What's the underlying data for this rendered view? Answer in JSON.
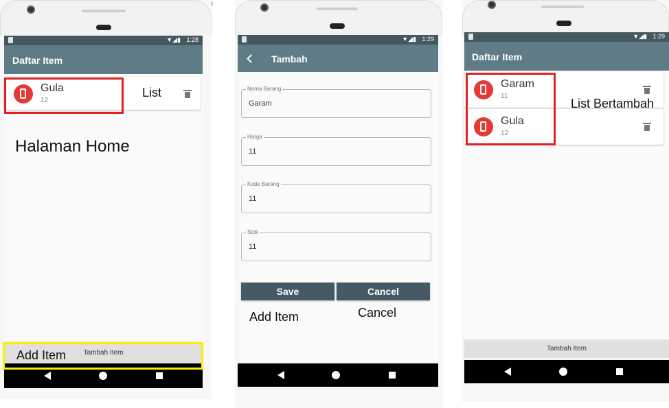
{
  "edge_fragment": "Bai",
  "phone1": {
    "status_time": "1:28",
    "appbar_title": "Daftar Item",
    "items": [
      {
        "title": "Gula",
        "subtitle": "12"
      }
    ],
    "bottom_button": "Tambah Item",
    "annotations": {
      "list": "List",
      "home": "Halaman Home",
      "add": "Add Item"
    }
  },
  "phone2": {
    "status_time": "1:29",
    "appbar_title": "Tambah",
    "fields": [
      {
        "label": "Nama Barang",
        "value": "Garam"
      },
      {
        "label": "Harga",
        "value": "11"
      },
      {
        "label": "Kode Barang",
        "value": "11"
      },
      {
        "label": "Stok",
        "value": "11"
      }
    ],
    "save_label": "Save",
    "cancel_label": "Cancel",
    "annotations": {
      "add": "Add Item",
      "cancel": "Cancel"
    }
  },
  "phone3": {
    "status_time": "1:29",
    "appbar_title": "Daftar Item",
    "items": [
      {
        "title": "Garam",
        "subtitle": "11"
      },
      {
        "title": "Gula",
        "subtitle": "12"
      }
    ],
    "bottom_button": "Tambah Item",
    "annotations": {
      "list": "List Bertambah"
    }
  },
  "colors": {
    "appbar": "#5f7c86",
    "statusbar": "#46585f",
    "accent_red": "#e53935",
    "button": "#455a64"
  }
}
